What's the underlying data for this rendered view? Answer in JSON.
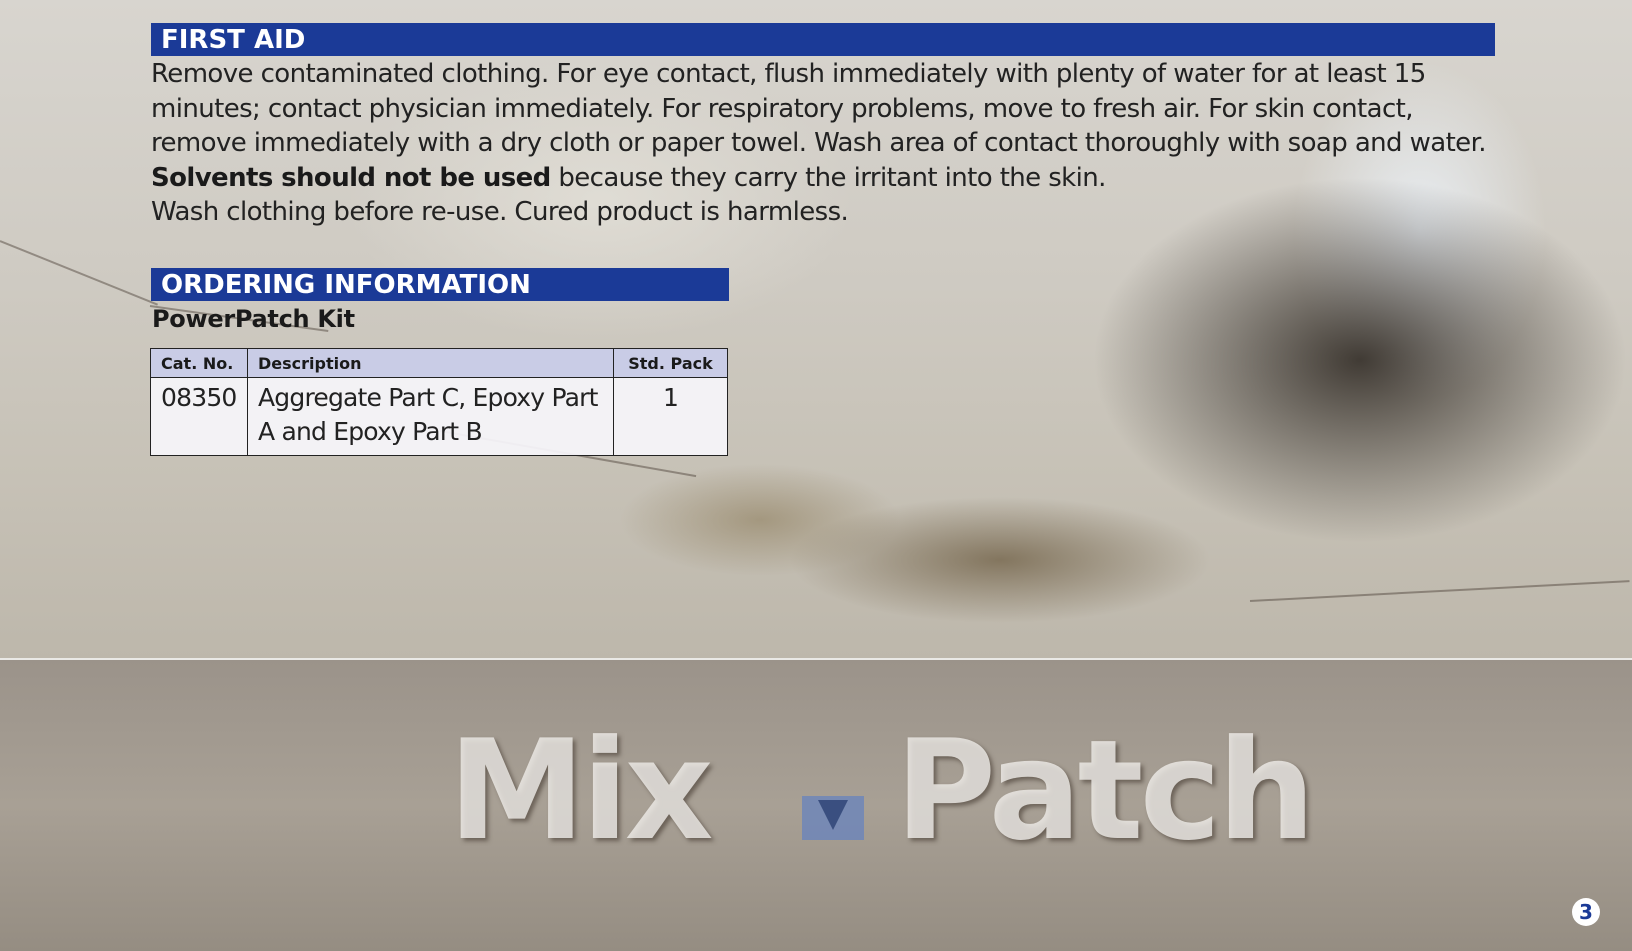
{
  "first_aid": {
    "heading": "FIRST AID",
    "line1": "Remove contaminated clothing. For eye contact, flush immediately with plenty of water for at least 15",
    "line2": "minutes; contact physician immediately. For respiratory problems, move to fresh air. For skin contact,",
    "line3": "remove immediately with a dry cloth or paper towel. Wash area of contact thoroughly with soap and water.",
    "line4_bold": "Solvents should not be used",
    "line4_rest": " because they carry the irritant into the skin.",
    "line5": "Wash clothing before re-use. Cured product is harmless."
  },
  "ordering": {
    "heading": "ORDERING INFORMATION",
    "kit_title": "PowerPatch Kit",
    "table": {
      "headers": [
        "Cat. No.",
        "Description",
        "Std. Pack"
      ],
      "rows": [
        [
          "08350",
          "Aggregate Part C, Epoxy Part A and Epoxy Part B",
          "1"
        ]
      ]
    }
  },
  "photo_text": {
    "word1": "Mix",
    "word2": "Patch"
  },
  "page_number": "3",
  "colors": {
    "band_blue": "#1b3a97",
    "table_header": "#c9cce6"
  }
}
